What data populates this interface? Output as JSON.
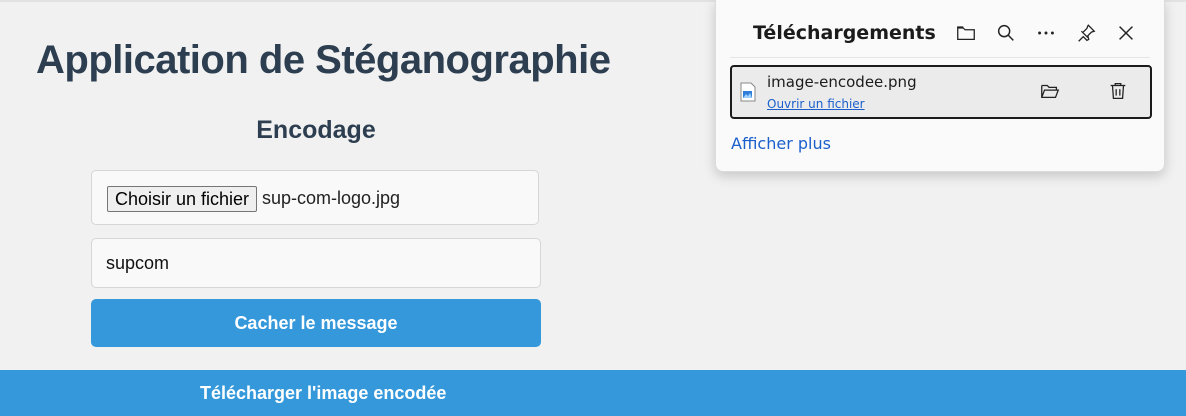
{
  "app": {
    "title": "Application de Stéganographie",
    "section_title": "Encodage",
    "file_button_label": "Choisir un fichier",
    "file_name": "sup-com-logo.jpg",
    "message_value": "supcom",
    "hide_button_label": "Cacher le message",
    "download_link_label": "Télécharger l'image encodée",
    "accent_color": "#3498db",
    "title_color": "#2c3e50"
  },
  "downloads_panel": {
    "title": "Téléchargements",
    "header_icons": [
      "folder-icon",
      "search-icon",
      "more-icon",
      "pin-icon",
      "close-icon"
    ],
    "item": {
      "file_name": "image-encodee.png",
      "open_link_label": "Ouvrir un fichier",
      "icons": [
        "image-file-icon",
        "open-folder-icon",
        "trash-icon"
      ]
    },
    "show_more_label": "Afficher plus"
  }
}
